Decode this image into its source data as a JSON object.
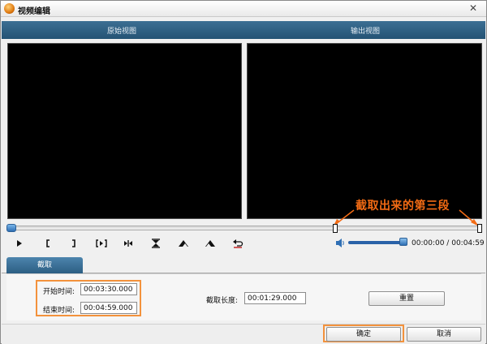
{
  "window": {
    "title": "视频编辑"
  },
  "views": {
    "original_label": "原始视图",
    "output_label": "输出视图"
  },
  "annotation": {
    "text": "截取出来的第三段",
    "color": "#f36b14"
  },
  "controls": {
    "play_icon": "play-icon",
    "mark_in_icon": "mark-in-bracket-icon",
    "mark_out_icon": "mark-out-bracket-icon",
    "play_selection_icon": "play-selection-icon",
    "step_icon": "step-icon",
    "icons_extra": [
      "hourglass-icon",
      "mountain-icon",
      "mountain-icon",
      "undo-icon"
    ],
    "time_current": "00:00:00",
    "time_separator": "/",
    "time_total": "00:04:59"
  },
  "tabs": {
    "cut_label": "截取"
  },
  "panel": {
    "start_label": "开始时间:",
    "start_value": "00:03:30.000",
    "end_label": "结束时间:",
    "end_value": "00:04:59.000",
    "length_label": "截取长度:",
    "length_value": "00:01:29.000",
    "reset_label": "重置"
  },
  "buttons": {
    "ok_label": "确定",
    "cancel_label": "取消"
  },
  "colors": {
    "header": "#2f5f82",
    "highlight": "#f3923c",
    "accent": "#2f6fb4"
  }
}
